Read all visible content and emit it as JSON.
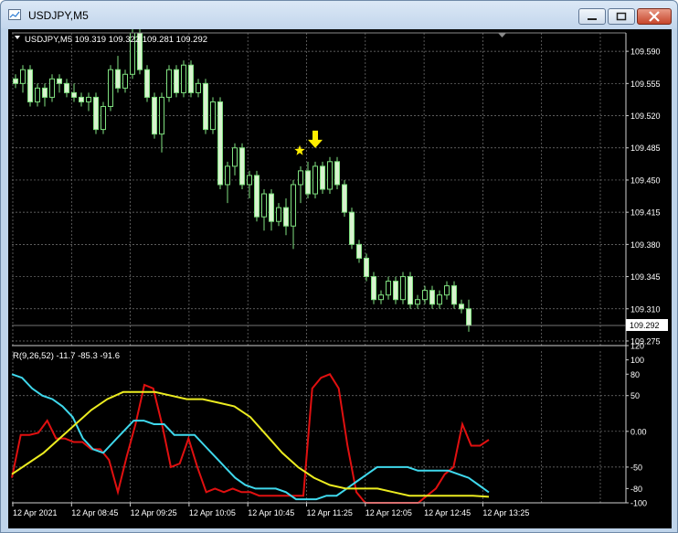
{
  "window": {
    "title": "USDJPY,M5"
  },
  "main_chart": {
    "info_label": "USDJPY,M5  109.319 109.322 109.281 109.292",
    "current_price_label": "109.292",
    "price_ticks": [
      "109.590",
      "109.555",
      "109.520",
      "109.485",
      "109.450",
      "109.415",
      "109.380",
      "109.345",
      "109.310",
      "109.275"
    ]
  },
  "indicator": {
    "label": "R(9,26,52) -11.7 -85.3 -91.6",
    "ticks": [
      "120",
      "100",
      "80",
      "50",
      "0.00",
      "-50",
      "-80",
      "-100"
    ]
  },
  "time_labels": [
    "12 Apr 2021",
    "12 Apr 08:45",
    "12 Apr 09:25",
    "12 Apr 10:05",
    "12 Apr 10:45",
    "12 Apr 11:25",
    "12 Apr 12:05",
    "12 Apr 12:45",
    "12 Apr 13:25"
  ],
  "colors": {
    "bull": "#000000",
    "bear": "#d9f2d0",
    "wick": "#7fe07f",
    "grid": "#7a7a7a",
    "line_red": "#e01010",
    "line_cyan": "#3fd8ec",
    "line_yellow": "#ecec20",
    "marker": "#ffee00"
  },
  "chart_data": [
    {
      "type": "candlestick",
      "symbol": "USDJPY",
      "timeframe": "M5",
      "ylim": [
        109.27,
        109.61
      ],
      "last": 109.292,
      "candles": [
        [
          109.56,
          109.565,
          109.55,
          109.555
        ],
        [
          109.555,
          109.575,
          109.545,
          109.57
        ],
        [
          109.57,
          109.575,
          109.53,
          109.535
        ],
        [
          109.535,
          109.555,
          109.53,
          109.55
        ],
        [
          109.55,
          109.555,
          109.53,
          109.54
        ],
        [
          109.54,
          109.565,
          109.535,
          109.56
        ],
        [
          109.56,
          109.565,
          109.545,
          109.555
        ],
        [
          109.555,
          109.56,
          109.54,
          109.545
        ],
        [
          109.545,
          109.555,
          109.535,
          109.54
        ],
        [
          109.54,
          109.545,
          109.53,
          109.535
        ],
        [
          109.535,
          109.545,
          109.525,
          109.54
        ],
        [
          109.54,
          109.545,
          109.5,
          109.505
        ],
        [
          109.505,
          109.535,
          109.5,
          109.53
        ],
        [
          109.53,
          109.575,
          109.525,
          109.57
        ],
        [
          109.57,
          109.585,
          109.545,
          109.55
        ],
        [
          109.55,
          109.57,
          109.545,
          109.565
        ],
        [
          109.565,
          109.615,
          109.56,
          109.61
        ],
        [
          109.61,
          109.615,
          109.565,
          109.57
        ],
        [
          109.57,
          109.575,
          109.535,
          109.54
        ],
        [
          109.54,
          109.545,
          109.495,
          109.5
        ],
        [
          109.5,
          109.545,
          109.48,
          109.54
        ],
        [
          109.54,
          109.575,
          109.535,
          109.57
        ],
        [
          109.57,
          109.575,
          109.54,
          109.545
        ],
        [
          109.545,
          109.58,
          109.54,
          109.575
        ],
        [
          109.575,
          109.58,
          109.54,
          109.545
        ],
        [
          109.545,
          109.56,
          109.54,
          109.555
        ],
        [
          109.555,
          109.56,
          109.5,
          109.505
        ],
        [
          109.505,
          109.54,
          109.5,
          109.535
        ],
        [
          109.535,
          109.54,
          109.44,
          109.445
        ],
        [
          109.445,
          109.47,
          109.425,
          109.465
        ],
        [
          109.465,
          109.49,
          109.455,
          109.485
        ],
        [
          109.485,
          109.49,
          109.44,
          109.445
        ],
        [
          109.445,
          109.46,
          109.43,
          109.455
        ],
        [
          109.455,
          109.46,
          109.405,
          109.41
        ],
        [
          109.41,
          109.44,
          109.395,
          109.435
        ],
        [
          109.435,
          109.44,
          109.395,
          109.405
        ],
        [
          109.405,
          109.425,
          109.4,
          109.42
        ],
        [
          109.42,
          109.43,
          109.39,
          109.4
        ],
        [
          109.4,
          109.45,
          109.375,
          109.445
        ],
        [
          109.445,
          109.465,
          109.425,
          109.46
        ],
        [
          109.46,
          109.47,
          109.43,
          109.435
        ],
        [
          109.435,
          109.47,
          109.43,
          109.465
        ],
        [
          109.465,
          109.47,
          109.435,
          109.44
        ],
        [
          109.44,
          109.475,
          109.435,
          109.47
        ],
        [
          109.47,
          109.475,
          109.44,
          109.445
        ],
        [
          109.445,
          109.45,
          109.41,
          109.415
        ],
        [
          109.415,
          109.42,
          109.375,
          109.38
        ],
        [
          109.38,
          109.385,
          109.36,
          109.365
        ],
        [
          109.365,
          109.37,
          109.34,
          109.345
        ],
        [
          109.345,
          109.35,
          109.315,
          109.32
        ],
        [
          109.32,
          109.33,
          109.315,
          109.325
        ],
        [
          109.325,
          109.345,
          109.32,
          109.34
        ],
        [
          109.34,
          109.345,
          109.315,
          109.32
        ],
        [
          109.32,
          109.35,
          109.315,
          109.345
        ],
        [
          109.345,
          109.35,
          109.31,
          109.315
        ],
        [
          109.315,
          109.325,
          109.31,
          109.32
        ],
        [
          109.32,
          109.335,
          109.315,
          109.33
        ],
        [
          109.33,
          109.335,
          109.31,
          109.315
        ],
        [
          109.315,
          109.33,
          109.31,
          109.325
        ],
        [
          109.325,
          109.34,
          109.32,
          109.335
        ],
        [
          109.335,
          109.34,
          109.31,
          109.315
        ],
        [
          109.315,
          109.32,
          109.305,
          109.31
        ],
        [
          109.31,
          109.32,
          109.285,
          109.292
        ]
      ],
      "annotations": [
        {
          "type": "arrow-down",
          "color": "#ffee00",
          "bar": 41
        },
        {
          "type": "star",
          "color": "#ffee00",
          "bar": 40
        }
      ]
    },
    {
      "type": "line",
      "title": "R(9,26,52)",
      "ylim": [
        -100,
        120
      ],
      "series": [
        {
          "name": "R(9)",
          "color": "#e01010",
          "values": [
            -65,
            -5,
            -5,
            -2,
            15,
            -10,
            -10,
            -15,
            -15,
            -25,
            -25,
            -40,
            -85,
            -35,
            10,
            65,
            60,
            10,
            -50,
            -45,
            -10,
            -50,
            -85,
            -80,
            -85,
            -80,
            -85,
            -85,
            -90,
            -90,
            -90,
            -90,
            -90,
            -90,
            60,
            75,
            80,
            60,
            -20,
            -85,
            -100,
            -100,
            -100,
            -100,
            -100,
            -100,
            -100,
            -90,
            -80,
            -60,
            -50,
            10,
            -20,
            -20,
            -11.7
          ]
        },
        {
          "name": "R(26)",
          "color": "#3fd8ec",
          "values": [
            80,
            75,
            60,
            50,
            45,
            35,
            20,
            -10,
            -25,
            -30,
            -15,
            0,
            15,
            15,
            10,
            10,
            -5,
            -5,
            -5,
            -20,
            -35,
            -50,
            -65,
            -75,
            -80,
            -80,
            -80,
            -85,
            -95,
            -95,
            -95,
            -90,
            -90,
            -80,
            -70,
            -60,
            -50,
            -50,
            -50,
            -50,
            -55,
            -55,
            -55,
            -55,
            -60,
            -65,
            -75,
            -85.3
          ]
        },
        {
          "name": "R(52)",
          "color": "#ecec20",
          "values": [
            -60,
            -45,
            -30,
            -10,
            10,
            30,
            45,
            55,
            55,
            55,
            50,
            45,
            45,
            40,
            35,
            20,
            -5,
            -30,
            -50,
            -65,
            -75,
            -80,
            -80,
            -80,
            -85,
            -90,
            -90,
            -90,
            -90,
            -90,
            -91.6
          ]
        }
      ]
    }
  ]
}
